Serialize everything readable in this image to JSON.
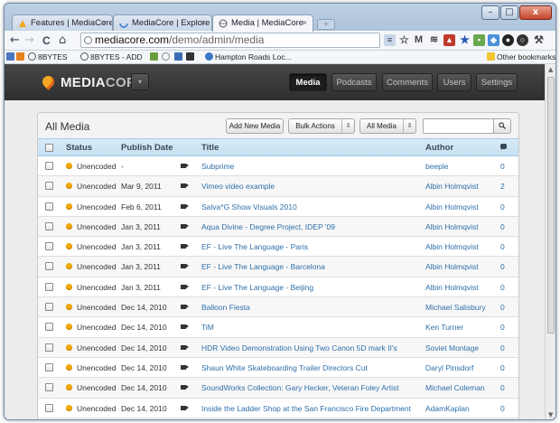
{
  "browser": {
    "tabs": [
      {
        "label": "Features | MediaCore",
        "close": "×"
      },
      {
        "label": "MediaCore | Explore",
        "close": "×"
      },
      {
        "label": "Media | MediaCore",
        "close": "×"
      }
    ],
    "window_controls": {
      "minimize": "–",
      "maximize": "□",
      "close": "x"
    },
    "nav": {
      "back": "←",
      "forward": "→",
      "reload": "C",
      "home": "⌂"
    },
    "url": {
      "host": "mediacore.com",
      "path": "/demo/admin/media"
    },
    "bookmarks": [
      {
        "label": "8BYTES",
        "icon": "globe-icon"
      },
      {
        "label": "8BYTES - ADD",
        "icon": "globe-icon"
      },
      {
        "label": "Hampton Roads Loc...",
        "icon": "globe-icon"
      }
    ],
    "other_bookmarks": "Other bookmarks"
  },
  "app": {
    "logo_media": "MEDIA",
    "logo_core": "CORE",
    "logo_menu": "▾",
    "nav": [
      "Media",
      "Podcasts",
      "Comments",
      "Users",
      "Settings"
    ],
    "active_nav": "Media"
  },
  "panel": {
    "title": "All Media",
    "add_button": "Add New Media",
    "bulk_actions": "Bulk Actions",
    "filter_select": "All Media",
    "select_chevron": "⇕",
    "search_placeholder": "",
    "search_icon": "🔍"
  },
  "table": {
    "headers": {
      "status": "Status",
      "publish_date": "Publish Date",
      "title": "Title",
      "author": "Author"
    },
    "rows": [
      {
        "status": "Unencoded",
        "date": "-",
        "title": "Subprime",
        "author": "beeple",
        "comments": "0"
      },
      {
        "status": "Unencoded",
        "date": "Mar 9, 2011",
        "title": "Vimeo video example",
        "author": "Albin Holmqvist",
        "comments": "2"
      },
      {
        "status": "Unencoded",
        "date": "Feb 6, 2011",
        "title": "Salva*G Show Visuals 2010",
        "author": "Albin Holmqvist",
        "comments": "0"
      },
      {
        "status": "Unencoded",
        "date": "Jan 3, 2011",
        "title": "Aqua Divine - Degree Project, IDEP '09",
        "author": "Albin Holmqvist",
        "comments": "0"
      },
      {
        "status": "Unencoded",
        "date": "Jan 3, 2011",
        "title": "EF - Live The Language - Paris",
        "author": "Albin Holmqvist",
        "comments": "0"
      },
      {
        "status": "Unencoded",
        "date": "Jan 3, 2011",
        "title": "EF - Live The Language - Barcelona",
        "author": "Albin Holmqvist",
        "comments": "0"
      },
      {
        "status": "Unencoded",
        "date": "Jan 3, 2011",
        "title": "EF - Live The Language - Beijing",
        "author": "Albin Holmqvist",
        "comments": "0"
      },
      {
        "status": "Unencoded",
        "date": "Dec 14, 2010",
        "title": "Balloon Fiesta",
        "author": "Michael Salisbury",
        "comments": "0"
      },
      {
        "status": "Unencoded",
        "date": "Dec 14, 2010",
        "title": "TiM",
        "author": "Ken Turner",
        "comments": "0"
      },
      {
        "status": "Unencoded",
        "date": "Dec 14, 2010",
        "title": "HDR Video Demonstration Using Two Canon 5D mark II's",
        "author": "Soviet Montage",
        "comments": "0"
      },
      {
        "status": "Unencoded",
        "date": "Dec 14, 2010",
        "title": "Shaun White Skateboarding Trailer Directors Cut",
        "author": "Daryl Pinsdorf",
        "comments": "0"
      },
      {
        "status": "Unencoded",
        "date": "Dec 14, 2010",
        "title": "SoundWorks Collection: Gary Hecker, Veteran Foley Artist",
        "author": "Michael Coleman",
        "comments": "0"
      },
      {
        "status": "Unencoded",
        "date": "Dec 14, 2010",
        "title": "Inside the Ladder Shop at the San Francisco Fire Department",
        "author": "AdamKaplan",
        "comments": "0"
      }
    ]
  },
  "colors": {
    "status_unencoded": "#f2a900",
    "link": "#2f6fa8",
    "header_bg": "#3a3a3a",
    "table_header_bg": "#c6e0f3"
  }
}
